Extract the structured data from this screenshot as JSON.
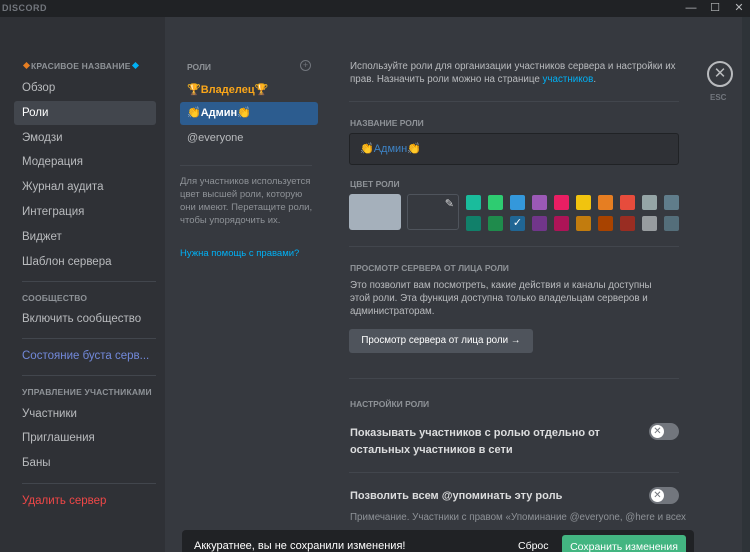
{
  "window": {
    "brand": "DISCORD",
    "controls": {
      "minimize": "—",
      "maximize": "☐",
      "close": "✕"
    }
  },
  "sidebar": {
    "server_name": "КРАСИВОЕ НАЗВАНИЕ",
    "items": [
      "Обзор",
      "Роли",
      "Эмодзи",
      "Модерация",
      "Журнал аудита",
      "Интеграция",
      "Виджет",
      "Шаблон сервера"
    ],
    "community_header": "СООБЩЕСТВО",
    "community_item": "Включить сообщество",
    "boost_status": "Состояние буста серв...",
    "members_header": "УПРАВЛЕНИЕ УЧАСТНИКАМИ",
    "members_items": [
      "Участники",
      "Приглашения",
      "Баны"
    ],
    "delete_server": "Удалить сервер"
  },
  "roles": {
    "header": "РОЛИ",
    "add": "+",
    "list": [
      {
        "icon": "🏆",
        "name": "Владелец",
        "icon2": "🏆"
      },
      {
        "icon": "👏",
        "name": "Админ",
        "icon2": "👏"
      },
      {
        "name": "@everyone"
      }
    ],
    "hint": "Для участников используется цвет высшей роли, которую они имеют. Перетащите роли, чтобы упорядочить их.",
    "help_link": "Нужна помощь с правами?"
  },
  "main": {
    "intro_text": "Используйте роли для организации участников сервера и настройки их прав. Назначить роли можно на странице",
    "intro_link": "участников",
    "intro_end": ".",
    "role_name_label": "НАЗВАНИЕ РОЛИ",
    "role_name_value": "👏Админ👏",
    "role_color_label": "ЦВЕТ РОЛИ",
    "eyedropper": "✎",
    "swatches_row1": [
      "#1abc9c",
      "#2ecc71",
      "#3498db",
      "#9b59b6",
      "#e91e63",
      "#f1c40f",
      "#e67e22",
      "#e74c3c",
      "#95a5a6",
      "#607d8b"
    ],
    "swatches_row2": [
      "#11806a",
      "#1f8b4c",
      "#206694",
      "#71368a",
      "#ad1457",
      "#c27c0e",
      "#a84300",
      "#992d22",
      "#979c9f",
      "#546e7a"
    ],
    "selected_swatch": "2",
    "check": "✓",
    "view_as_label": "ПРОСМОТР СЕРВЕРА ОТ ЛИЦА РОЛИ",
    "view_as_text": "Это позволит вам посмотреть, какие действия и каналы доступны этой роли. Эта функция доступна только владельцам серверов и администраторам.",
    "view_as_button": "Просмотр сервера от лица роли →",
    "settings_label": "НАСТРОЙКИ РОЛИ",
    "setting1": "Показывать участников с ролью отдельно от остальных участников в сети",
    "setting2": "Позволить всем @упоминать эту роль",
    "toggle_off": "✕",
    "note": "Примечание. Участники с правом «Упоминание @everyone, @here и всех"
  },
  "esc": {
    "icon": "✕",
    "label": "ESC"
  },
  "unsaved": {
    "text": "Аккуратнее, вы не сохранили изменения!",
    "reset": "Сброс",
    "save": "Сохранить изменения"
  }
}
